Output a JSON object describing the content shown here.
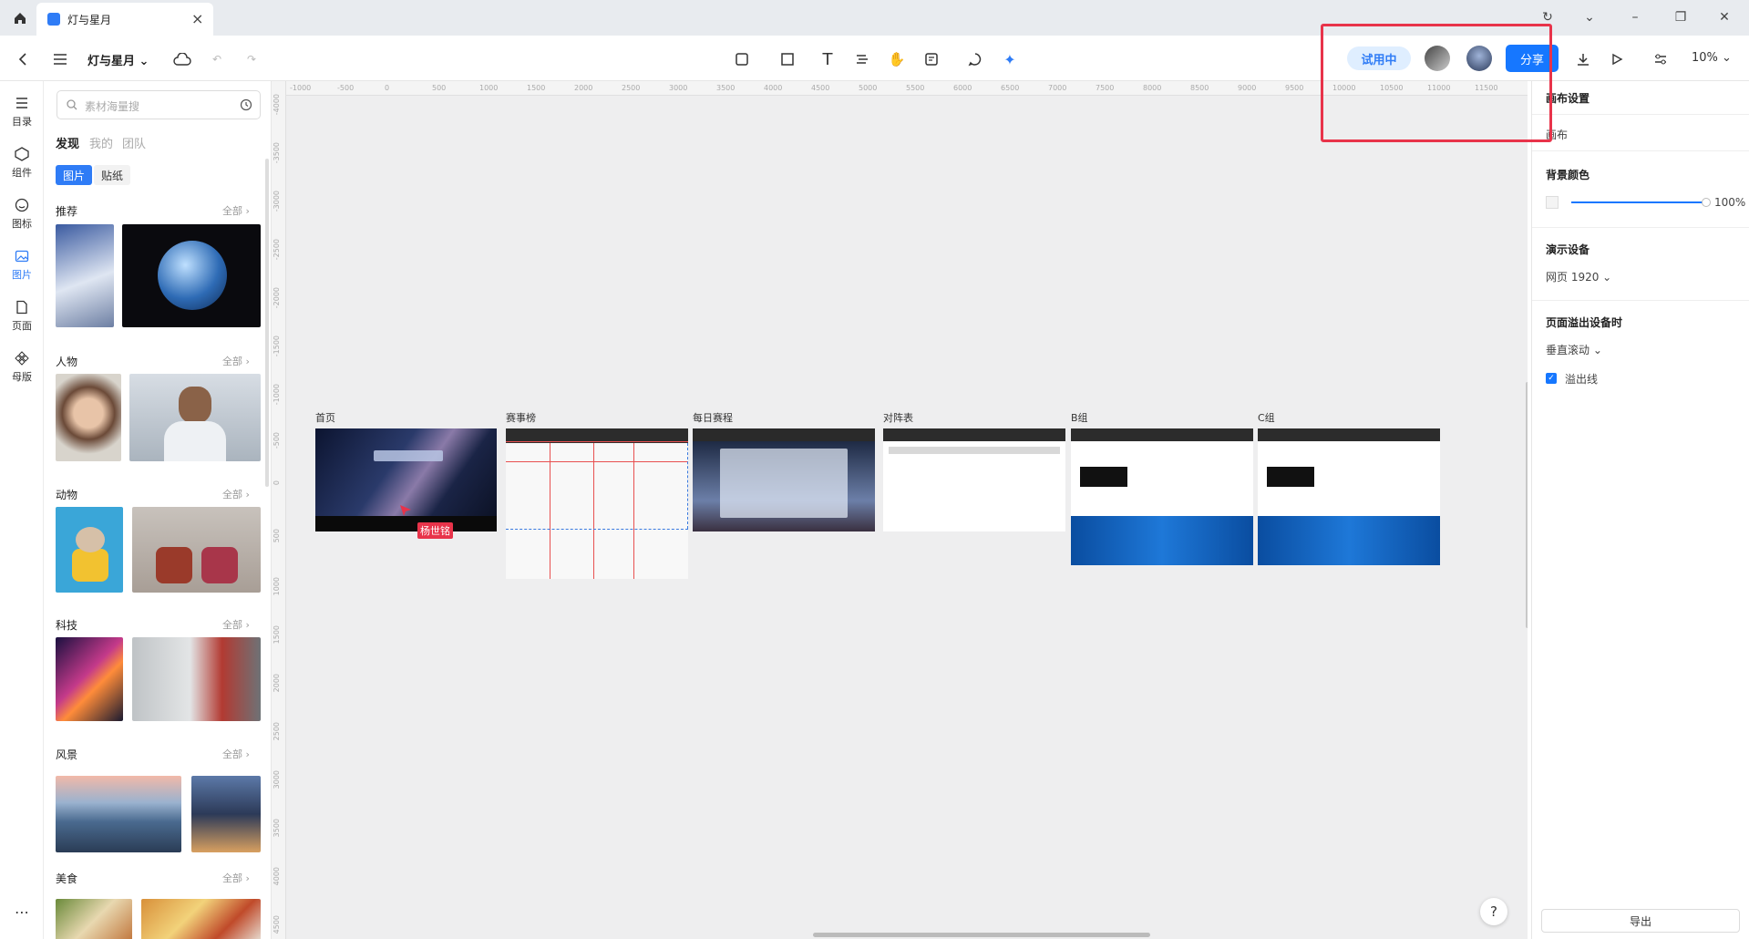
{
  "titlebar": {
    "tab_title": "灯与星月"
  },
  "toolbar": {
    "project_name": "灯与星月",
    "trial_label": "试用中",
    "share_label": "分享",
    "zoom": "10%"
  },
  "left_rail": [
    {
      "label": "目录",
      "icon": "outline-list-icon"
    },
    {
      "label": "组件",
      "icon": "component-icon"
    },
    {
      "label": "图标",
      "icon": "smiley-icon"
    },
    {
      "label": "图片",
      "icon": "image-icon",
      "active": true
    },
    {
      "label": "页面",
      "icon": "page-icon"
    },
    {
      "label": "母版",
      "icon": "master-icon"
    }
  ],
  "asset_panel": {
    "search_placeholder": "素材海量搜",
    "tabs": [
      "发现",
      "我的",
      "团队"
    ],
    "chips": [
      "图片",
      "贴纸"
    ],
    "all_label": "全部",
    "categories": [
      "推荐",
      "人物",
      "动物",
      "科技",
      "风景",
      "美食"
    ]
  },
  "canvas": {
    "ruler_x": [
      "-1000",
      "-500",
      "0",
      "500",
      "1000",
      "1500",
      "2000",
      "2500",
      "3000",
      "3500",
      "4000",
      "4500",
      "5000",
      "5500",
      "6000",
      "6500",
      "7000",
      "7500",
      "8000",
      "8500",
      "9000",
      "9500",
      "10000",
      "10500",
      "11000",
      "11500"
    ],
    "ruler_y": [
      "-4000",
      "-3500",
      "-3000",
      "-2500",
      "-2000",
      "-1500",
      "-1000",
      "-500",
      "0",
      "500",
      "1000",
      "1500",
      "2000",
      "2500",
      "3000",
      "3500",
      "4000",
      "4500"
    ],
    "frames": [
      "首页",
      "赛事榜",
      "每日赛程",
      "对阵表",
      "B组",
      "C组"
    ],
    "cursor_user": "杨世铭",
    "help": "?"
  },
  "right_panel": {
    "canvas_settings": "画布设置",
    "canvas_tab": "画布",
    "bg_color_label": "背景颜色",
    "opacity": "100%",
    "device_label": "演示设备",
    "device_value": "网页 1920",
    "overflow_label": "页面溢出设备时",
    "overflow_value": "垂直滚动",
    "overflow_line": "溢出线",
    "export": "导出"
  }
}
